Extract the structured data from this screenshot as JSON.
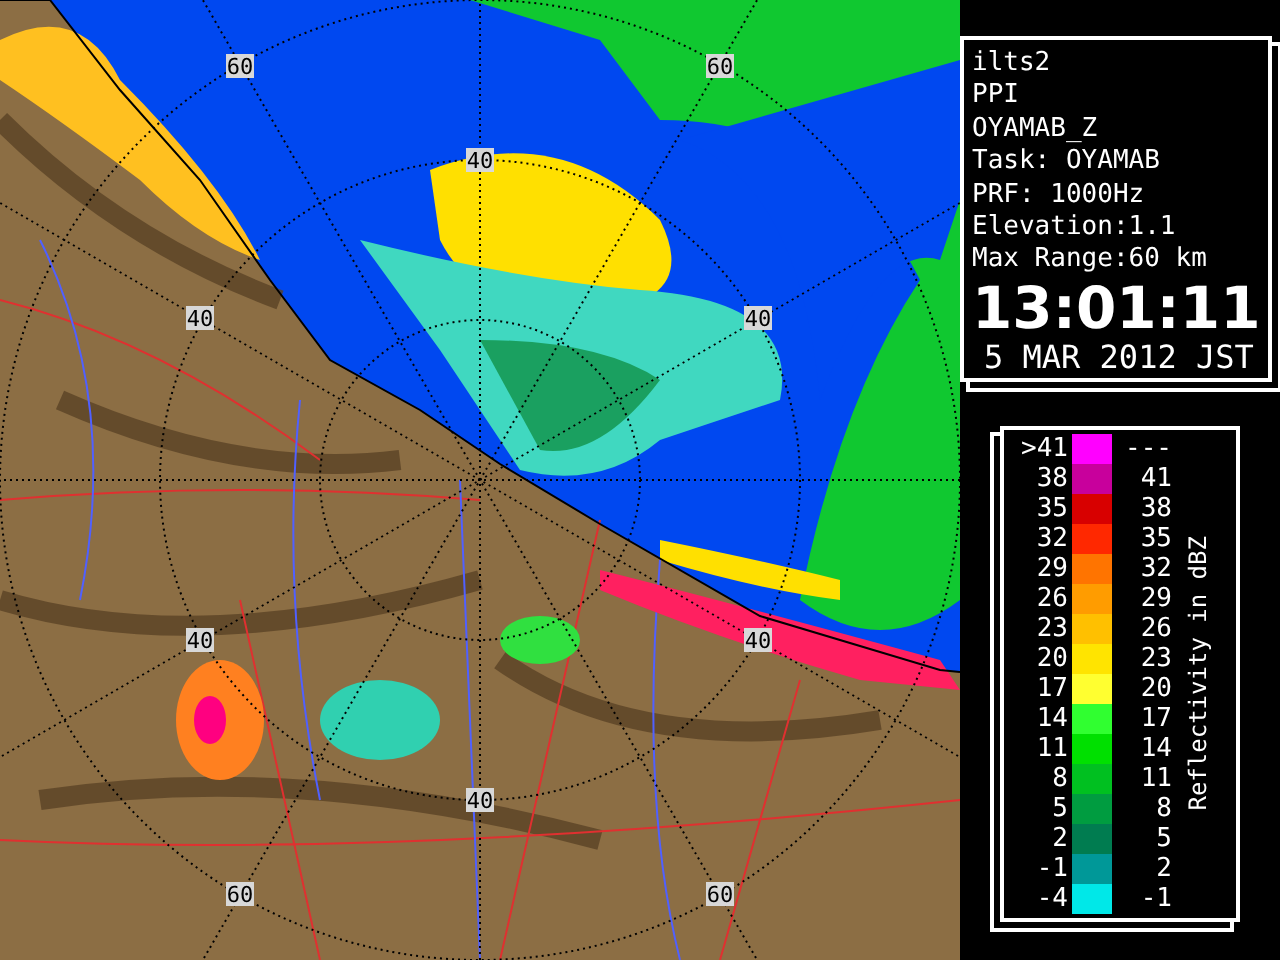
{
  "map": {
    "range_labels": [
      "60",
      "60",
      "40",
      "40",
      "40",
      "40",
      "40",
      "40",
      "60",
      "60"
    ]
  },
  "info": {
    "lines": [
      "ilts2",
      "PPI",
      "OYAMAB_Z",
      "Task: OYAMAB",
      "PRF: 1000Hz",
      "Elevation:1.1",
      "Max Range:60 km"
    ],
    "time": "13:01:11",
    "date": "5 MAR 2012 JST"
  },
  "legend": {
    "title": "Reflectivity in dBZ",
    "bins": [
      {
        "low": ">41",
        "high": "---",
        "color": "#ff00ff"
      },
      {
        "low": "38",
        "high": "41",
        "color": "#c8009c"
      },
      {
        "low": "35",
        "high": "38",
        "color": "#d80000"
      },
      {
        "low": "32",
        "high": "35",
        "color": "#ff2800"
      },
      {
        "low": "29",
        "high": "32",
        "color": "#ff7400"
      },
      {
        "low": "26",
        "high": "29",
        "color": "#ff9c00"
      },
      {
        "low": "23",
        "high": "26",
        "color": "#ffc000"
      },
      {
        "low": "20",
        "high": "23",
        "color": "#ffe400"
      },
      {
        "low": "17",
        "high": "20",
        "color": "#ffff30"
      },
      {
        "low": "14",
        "high": "17",
        "color": "#30ff30"
      },
      {
        "low": "11",
        "high": "14",
        "color": "#00e000"
      },
      {
        "low": "8",
        "high": "11",
        "color": "#00c020"
      },
      {
        "low": "5",
        "high": "8",
        "color": "#009c40"
      },
      {
        "low": "2",
        "high": "5",
        "color": "#007c50"
      },
      {
        "low": "-1",
        "high": "2",
        "color": "#009898"
      },
      {
        "low": "-4",
        "high": "-1",
        "color": "#00e8e8"
      }
    ]
  }
}
